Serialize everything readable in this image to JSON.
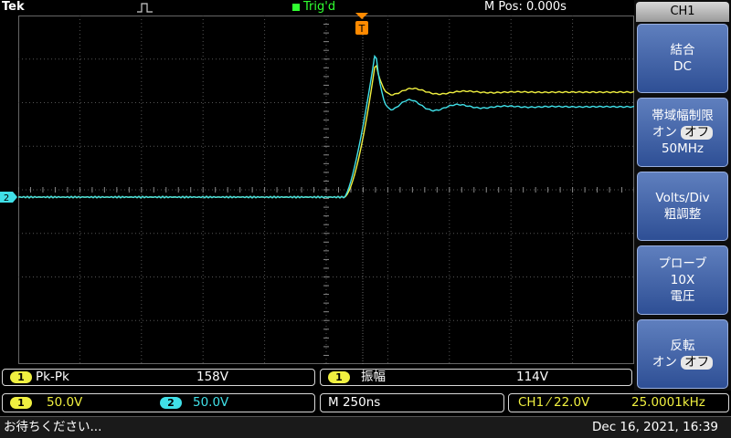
{
  "topbar": {
    "brand": "Tek",
    "trigger_state": "Trig'd",
    "position": "M Pos: 0.000s"
  },
  "markers": {
    "trigger_marker": "T",
    "ch2_ground_marker": "2"
  },
  "side_menu": {
    "title": "CH1",
    "coupling": {
      "line1": "結合",
      "line2": "DC"
    },
    "bandwidth": {
      "line1": "帯域幅制限",
      "on": "オン",
      "off": "オフ",
      "line3": "50MHz"
    },
    "volts_div": {
      "line1": "Volts/Div",
      "line2": "粗調整"
    },
    "probe": {
      "line1": "プローブ",
      "line2": "10X",
      "line3": "電圧"
    },
    "invert": {
      "line1": "反転",
      "on": "オン",
      "off": "オフ"
    }
  },
  "measurements": [
    {
      "channel": "1",
      "label": "Pk-Pk",
      "value": "158V"
    },
    {
      "channel": "1",
      "label": "振幅",
      "value": "114V"
    }
  ],
  "status": {
    "ch1_badge": "1",
    "ch1_scale": "50.0V",
    "ch2_badge": "2",
    "ch2_scale": "50.0V",
    "timebase": "M 250ns",
    "trigger": "CH1 ⁄ 22.0V",
    "frequency": "25.0001kHz"
  },
  "footer": {
    "message": "お待ちください...",
    "datetime": "Dec 16, 2021, 16:39"
  },
  "colors": {
    "ch1": "#f0f040",
    "ch2": "#40e0e8",
    "menu_button": "#3e5fa8",
    "trigger_marker": "#ff8a00"
  }
}
